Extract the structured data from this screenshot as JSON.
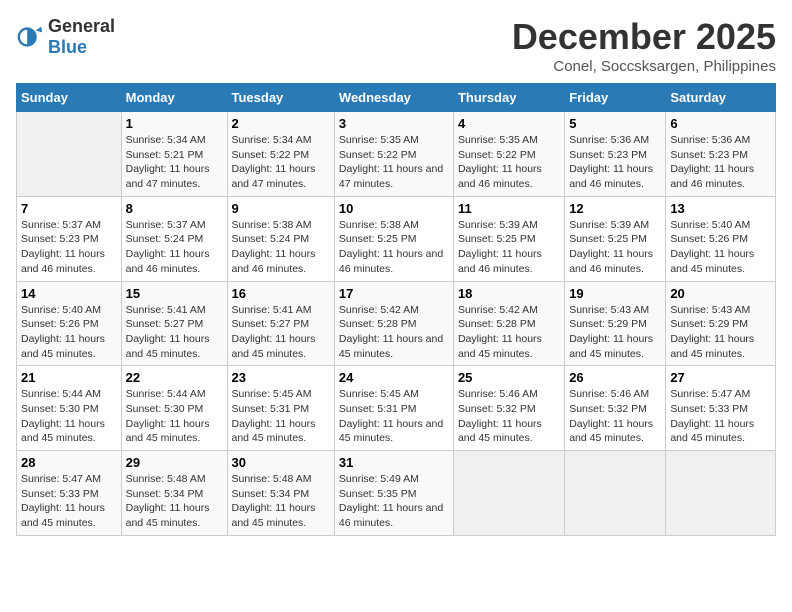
{
  "header": {
    "logo_general": "General",
    "logo_blue": "Blue",
    "title": "December 2025",
    "subtitle": "Conel, Soccsksargen, Philippines"
  },
  "days_of_week": [
    "Sunday",
    "Monday",
    "Tuesday",
    "Wednesday",
    "Thursday",
    "Friday",
    "Saturday"
  ],
  "weeks": [
    [
      {
        "day": "",
        "sunrise": "",
        "sunset": "",
        "daylight": ""
      },
      {
        "day": "1",
        "sunrise": "Sunrise: 5:34 AM",
        "sunset": "Sunset: 5:21 PM",
        "daylight": "Daylight: 11 hours and 47 minutes."
      },
      {
        "day": "2",
        "sunrise": "Sunrise: 5:34 AM",
        "sunset": "Sunset: 5:22 PM",
        "daylight": "Daylight: 11 hours and 47 minutes."
      },
      {
        "day": "3",
        "sunrise": "Sunrise: 5:35 AM",
        "sunset": "Sunset: 5:22 PM",
        "daylight": "Daylight: 11 hours and 47 minutes."
      },
      {
        "day": "4",
        "sunrise": "Sunrise: 5:35 AM",
        "sunset": "Sunset: 5:22 PM",
        "daylight": "Daylight: 11 hours and 46 minutes."
      },
      {
        "day": "5",
        "sunrise": "Sunrise: 5:36 AM",
        "sunset": "Sunset: 5:23 PM",
        "daylight": "Daylight: 11 hours and 46 minutes."
      },
      {
        "day": "6",
        "sunrise": "Sunrise: 5:36 AM",
        "sunset": "Sunset: 5:23 PM",
        "daylight": "Daylight: 11 hours and 46 minutes."
      }
    ],
    [
      {
        "day": "7",
        "sunrise": "Sunrise: 5:37 AM",
        "sunset": "Sunset: 5:23 PM",
        "daylight": "Daylight: 11 hours and 46 minutes."
      },
      {
        "day": "8",
        "sunrise": "Sunrise: 5:37 AM",
        "sunset": "Sunset: 5:24 PM",
        "daylight": "Daylight: 11 hours and 46 minutes."
      },
      {
        "day": "9",
        "sunrise": "Sunrise: 5:38 AM",
        "sunset": "Sunset: 5:24 PM",
        "daylight": "Daylight: 11 hours and 46 minutes."
      },
      {
        "day": "10",
        "sunrise": "Sunrise: 5:38 AM",
        "sunset": "Sunset: 5:25 PM",
        "daylight": "Daylight: 11 hours and 46 minutes."
      },
      {
        "day": "11",
        "sunrise": "Sunrise: 5:39 AM",
        "sunset": "Sunset: 5:25 PM",
        "daylight": "Daylight: 11 hours and 46 minutes."
      },
      {
        "day": "12",
        "sunrise": "Sunrise: 5:39 AM",
        "sunset": "Sunset: 5:25 PM",
        "daylight": "Daylight: 11 hours and 46 minutes."
      },
      {
        "day": "13",
        "sunrise": "Sunrise: 5:40 AM",
        "sunset": "Sunset: 5:26 PM",
        "daylight": "Daylight: 11 hours and 45 minutes."
      }
    ],
    [
      {
        "day": "14",
        "sunrise": "Sunrise: 5:40 AM",
        "sunset": "Sunset: 5:26 PM",
        "daylight": "Daylight: 11 hours and 45 minutes."
      },
      {
        "day": "15",
        "sunrise": "Sunrise: 5:41 AM",
        "sunset": "Sunset: 5:27 PM",
        "daylight": "Daylight: 11 hours and 45 minutes."
      },
      {
        "day": "16",
        "sunrise": "Sunrise: 5:41 AM",
        "sunset": "Sunset: 5:27 PM",
        "daylight": "Daylight: 11 hours and 45 minutes."
      },
      {
        "day": "17",
        "sunrise": "Sunrise: 5:42 AM",
        "sunset": "Sunset: 5:28 PM",
        "daylight": "Daylight: 11 hours and 45 minutes."
      },
      {
        "day": "18",
        "sunrise": "Sunrise: 5:42 AM",
        "sunset": "Sunset: 5:28 PM",
        "daylight": "Daylight: 11 hours and 45 minutes."
      },
      {
        "day": "19",
        "sunrise": "Sunrise: 5:43 AM",
        "sunset": "Sunset: 5:29 PM",
        "daylight": "Daylight: 11 hours and 45 minutes."
      },
      {
        "day": "20",
        "sunrise": "Sunrise: 5:43 AM",
        "sunset": "Sunset: 5:29 PM",
        "daylight": "Daylight: 11 hours and 45 minutes."
      }
    ],
    [
      {
        "day": "21",
        "sunrise": "Sunrise: 5:44 AM",
        "sunset": "Sunset: 5:30 PM",
        "daylight": "Daylight: 11 hours and 45 minutes."
      },
      {
        "day": "22",
        "sunrise": "Sunrise: 5:44 AM",
        "sunset": "Sunset: 5:30 PM",
        "daylight": "Daylight: 11 hours and 45 minutes."
      },
      {
        "day": "23",
        "sunrise": "Sunrise: 5:45 AM",
        "sunset": "Sunset: 5:31 PM",
        "daylight": "Daylight: 11 hours and 45 minutes."
      },
      {
        "day": "24",
        "sunrise": "Sunrise: 5:45 AM",
        "sunset": "Sunset: 5:31 PM",
        "daylight": "Daylight: 11 hours and 45 minutes."
      },
      {
        "day": "25",
        "sunrise": "Sunrise: 5:46 AM",
        "sunset": "Sunset: 5:32 PM",
        "daylight": "Daylight: 11 hours and 45 minutes."
      },
      {
        "day": "26",
        "sunrise": "Sunrise: 5:46 AM",
        "sunset": "Sunset: 5:32 PM",
        "daylight": "Daylight: 11 hours and 45 minutes."
      },
      {
        "day": "27",
        "sunrise": "Sunrise: 5:47 AM",
        "sunset": "Sunset: 5:33 PM",
        "daylight": "Daylight: 11 hours and 45 minutes."
      }
    ],
    [
      {
        "day": "28",
        "sunrise": "Sunrise: 5:47 AM",
        "sunset": "Sunset: 5:33 PM",
        "daylight": "Daylight: 11 hours and 45 minutes."
      },
      {
        "day": "29",
        "sunrise": "Sunrise: 5:48 AM",
        "sunset": "Sunset: 5:34 PM",
        "daylight": "Daylight: 11 hours and 45 minutes."
      },
      {
        "day": "30",
        "sunrise": "Sunrise: 5:48 AM",
        "sunset": "Sunset: 5:34 PM",
        "daylight": "Daylight: 11 hours and 45 minutes."
      },
      {
        "day": "31",
        "sunrise": "Sunrise: 5:49 AM",
        "sunset": "Sunset: 5:35 PM",
        "daylight": "Daylight: 11 hours and 46 minutes."
      },
      {
        "day": "",
        "sunrise": "",
        "sunset": "",
        "daylight": ""
      },
      {
        "day": "",
        "sunrise": "",
        "sunset": "",
        "daylight": ""
      },
      {
        "day": "",
        "sunrise": "",
        "sunset": "",
        "daylight": ""
      }
    ]
  ]
}
